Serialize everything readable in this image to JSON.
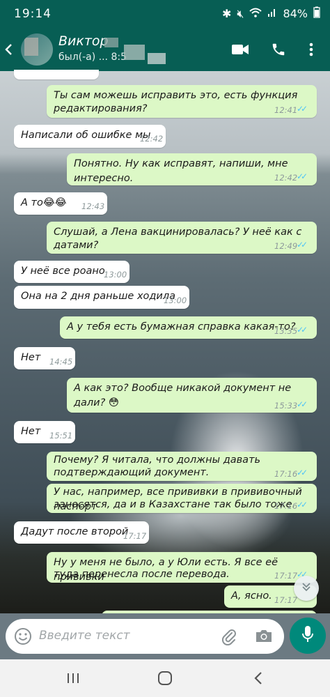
{
  "status_bar": {
    "time": "19:14",
    "battery": "84%"
  },
  "header": {
    "contact_name": "Виктор",
    "contact_status": "был(-а) ... 8:5"
  },
  "messages": [
    {
      "dir": "out",
      "text1": "Ты сам можешь исправить это, есть функция",
      "text2": "редактирования?",
      "time": "12:41"
    },
    {
      "dir": "in",
      "text1": "Написали об ошибке мы",
      "time": "12:42"
    },
    {
      "dir": "out",
      "text1": "Понятно. Ну как исправят, напиши, мне интересно.",
      "time": "12:42"
    },
    {
      "dir": "in",
      "text1": "А то😂😂",
      "time": "12:43"
    },
    {
      "dir": "out",
      "text1": "Слушай, а Лена вакцинировалась? У неё как с",
      "text2": "датами?",
      "time": "12:49"
    },
    {
      "dir": "in",
      "text1": "У неё все роано",
      "time": "13:00"
    },
    {
      "dir": "in",
      "text1": "Она на 2 дня раньше ходила",
      "time": "13:00"
    },
    {
      "dir": "out",
      "text1": "А у тебя есть бумажная справка какая-то?",
      "time": "13:35"
    },
    {
      "dir": "in",
      "text1": "Нет",
      "time": "14:45"
    },
    {
      "dir": "out",
      "text1": "А как это? Вообще никакой документ не дали? 😳",
      "time": "15:33"
    },
    {
      "dir": "in",
      "text1": "Нет",
      "time": "15:51"
    },
    {
      "dir": "out",
      "text1": "Почему? Я читала, что должны давать",
      "text2": "подтверждающий документ.",
      "time": "17:16"
    },
    {
      "dir": "out",
      "text1": "У нас, например, все прививки в прививочный паспорт",
      "text2": "заносятся, да и в Казахстане так было тоже.",
      "time": "17:16"
    },
    {
      "dir": "in",
      "text1": "Дадут после второй",
      "time": "17:17"
    },
    {
      "dir": "out",
      "text1": "Ну у меня не было, а у Юли есть. Я все её прививки",
      "text2": "туда перенесла после перевода.",
      "time": "17:17"
    },
    {
      "dir": "out",
      "text1": "А, ясно.",
      "time": "17:17"
    }
  ],
  "input": {
    "placeholder": "Введите текст"
  },
  "colors": {
    "header": "#075e54",
    "outgoing": "#dcf8c6",
    "incoming": "#ffffff",
    "tick": "#4fc3f7",
    "mic": "#00897b"
  },
  "icons": [
    "back-icon",
    "video-call-icon",
    "phone-icon",
    "more-icon",
    "emoji-icon",
    "attach-icon",
    "camera-icon",
    "mic-icon",
    "scroll-down-icon",
    "nav-recents-icon",
    "nav-home-icon",
    "nav-back-icon"
  ]
}
